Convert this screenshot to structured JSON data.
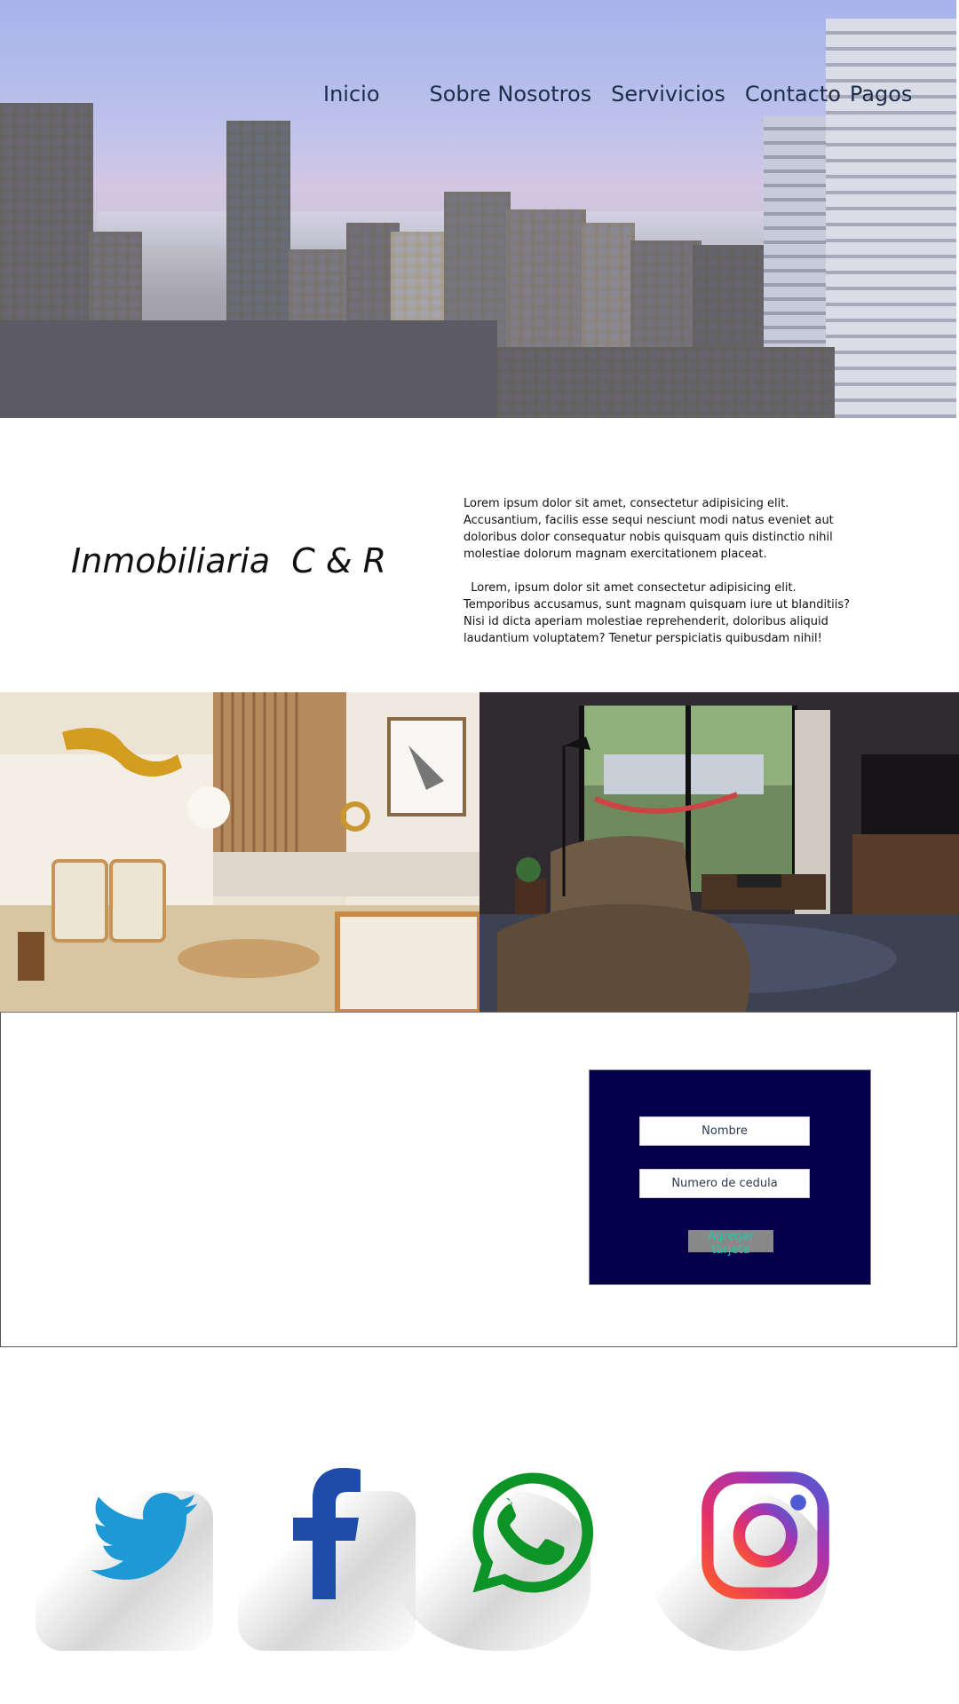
{
  "nav": {
    "items": [
      {
        "label": "Inicio"
      },
      {
        "label": "Sobre Nosotros"
      },
      {
        "label": "Servivicios"
      },
      {
        "label": "Contacto"
      },
      {
        "label": "Pagos"
      }
    ]
  },
  "intro": {
    "brand": "Inmobiliaria  C & R",
    "paragraphs": [
      "Lorem ipsum dolor sit amet, consectetur adipisicing elit. Accusantium, facilis esse sequi nesciunt modi natus eveniet aut doloribus dolor consequatur nobis quisquam quis distinctio nihil molestiae dolorum magnam exercitationem placeat.",
      "  Lorem, ipsum dolor sit amet consectetur adipisicing elit. Temporibus accusamus, sunt magnam quisquam iure ut blanditiis? Nisi id dicta aperiam molestiae reprehenderit, doloribus aliquid laudantium voluptatem? Tenetur perspiciatis quibusdam nihil!"
    ]
  },
  "form": {
    "name_placeholder": "Nombre",
    "id_placeholder": "Numero de cedula",
    "submit_label": "Agregar tarjeta"
  },
  "colors": {
    "form_bg": "#06004a",
    "twitter": "#1d9ad6",
    "facebook": "#1f4ba8",
    "whatsapp": "#0d9427"
  },
  "social": {
    "icons": [
      "twitter-icon",
      "facebook-icon",
      "whatsapp-icon",
      "instagram-icon"
    ]
  }
}
